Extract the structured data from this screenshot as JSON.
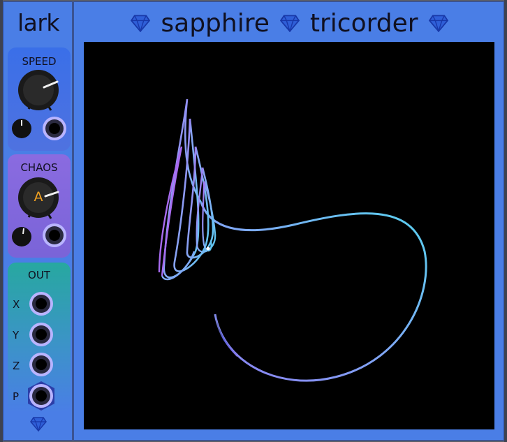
{
  "lark": {
    "title": "lark",
    "speed_label": "SPEED",
    "chaos_label": "CHAOS",
    "chaos_knob_letter": "A",
    "out_label": "OUT",
    "ports": [
      "X",
      "Y",
      "Z",
      "P"
    ]
  },
  "tricorder": {
    "title_left": "sapphire",
    "title_right": "tricorder"
  },
  "colors": {
    "panel_bg": "#4a7ee6",
    "speed_panel": "#3a6fe8",
    "chaos_panel": "#8a6be0",
    "out_panel": "#27a8a0",
    "trace_start": "#b06bf0",
    "trace_end": "#56c8f0",
    "port_ring": "#b9b4ff"
  },
  "icons": [
    "diamond-icon"
  ]
}
